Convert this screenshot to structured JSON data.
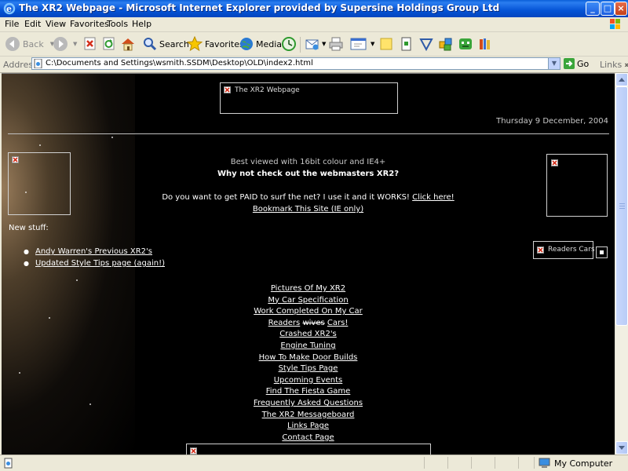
{
  "window": {
    "title": "The XR2 Webpage - Microsoft Internet Explorer provided by Supersine Holdings Group Ltd",
    "minimize_label": "_",
    "maximize_label": "□",
    "close_label": "×"
  },
  "menu": {
    "file": "File",
    "edit": "Edit",
    "view": "View",
    "favorites": "Favorites",
    "tools": "Tools",
    "help": "Help"
  },
  "toolbar": {
    "back": "Back",
    "search": "Search",
    "favorites": "Favorites",
    "media": "Media"
  },
  "address": {
    "label": "Address",
    "url": "C:\\Documents and Settings\\wsmith.SSDM\\Desktop\\OLD\\index2.html",
    "go": "Go",
    "links": "Links",
    "links_chevron": "»"
  },
  "page": {
    "banner_alt": "The XR2 Webpage",
    "date": "Thursday 9 December, 2004",
    "best_viewed": "Best viewed with 16bit colour and IE4+",
    "webmaster_line": "Why not check out the webmasters XR2?",
    "paid_text": "Do you want to get PAID to surf the net? I use it and it WORKS!",
    "click_here": "Click here!",
    "bookmark": "Bookmark This Site (IE only)",
    "new_stuff": "New stuff:",
    "new_items": [
      "Andy Warren's Previous XR2's",
      "Updated Style Tips page (again!)"
    ],
    "readers_cars_alt": "Readers Cars",
    "nav": [
      "Pictures Of My XR2",
      "My Car Specification",
      "Work Completed On My Car",
      "Readers",
      "wives",
      "Cars!",
      "Crashed XR2's",
      "Engine Tuning",
      "How To Make Door Builds",
      "Style Tips Page",
      "Upcoming Events",
      "Find The Fiesta Game",
      "Frequently Asked Questions",
      "The XR2 Messageboard",
      "Links Page",
      "Contact Page"
    ]
  },
  "status": {
    "zone": "My Computer"
  },
  "colors": {
    "titlebar": "#0554d6",
    "page_bg": "#000000",
    "text": "#ffffff",
    "chrome": "#ece9d8"
  }
}
